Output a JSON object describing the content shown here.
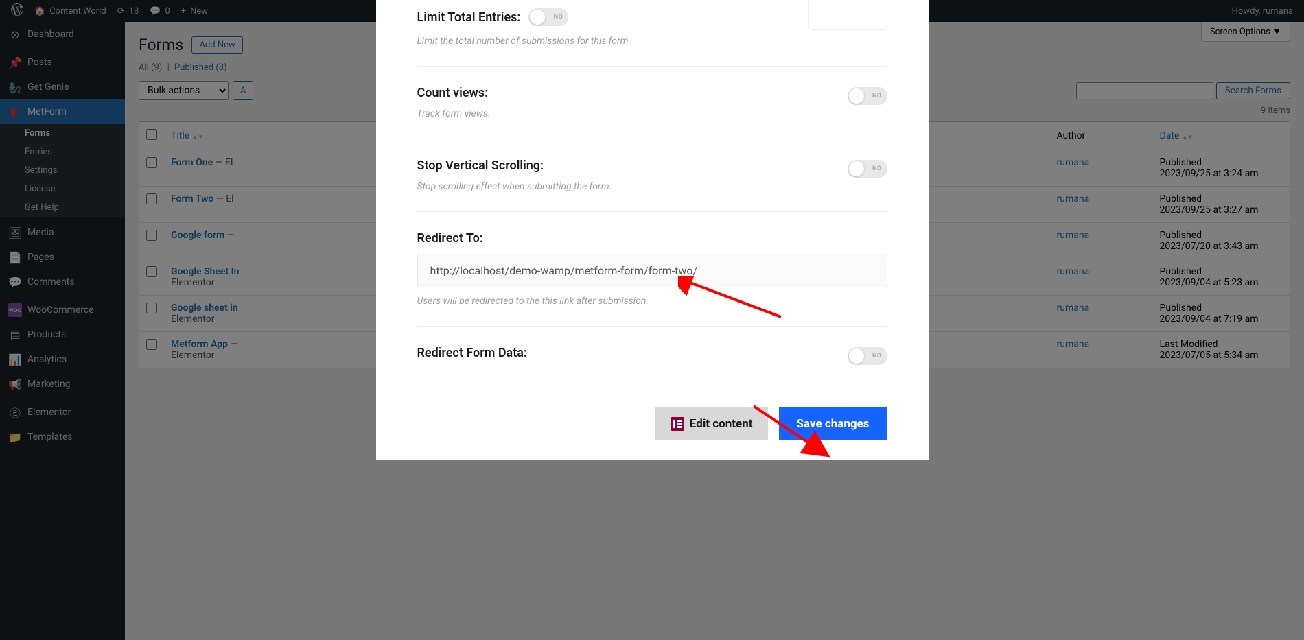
{
  "admin_bar": {
    "site_name": "Content World",
    "updates_count": "18",
    "comments_count": "0",
    "new_label": "New",
    "howdy": "Howdy, rumana"
  },
  "sidebar": {
    "items": [
      {
        "label": "Dashboard",
        "icon": "dashboard"
      },
      {
        "label": "Posts",
        "icon": "pin"
      },
      {
        "label": "Get Genie",
        "icon": "genie"
      },
      {
        "label": "MetForm",
        "icon": "metform",
        "active": true
      },
      {
        "label": "Media",
        "icon": "media"
      },
      {
        "label": "Pages",
        "icon": "pages"
      },
      {
        "label": "Comments",
        "icon": "comments"
      },
      {
        "label": "WooCommerce",
        "icon": "woo"
      },
      {
        "label": "Products",
        "icon": "products"
      },
      {
        "label": "Analytics",
        "icon": "analytics"
      },
      {
        "label": "Marketing",
        "icon": "marketing"
      },
      {
        "label": "Elementor",
        "icon": "elementor"
      },
      {
        "label": "Templates",
        "icon": "templates"
      }
    ],
    "submenu": [
      {
        "label": "Forms",
        "current": true
      },
      {
        "label": "Entries"
      },
      {
        "label": "Settings"
      },
      {
        "label": "License"
      },
      {
        "label": "Get Help"
      }
    ]
  },
  "screen_options": "Screen Options",
  "page": {
    "title": "Forms",
    "add_new": "Add New",
    "filters": {
      "all_label": "All",
      "all_count": "(9)",
      "published_label": "Published",
      "published_count": "(8)"
    },
    "bulk_actions": "Bulk actions",
    "search_button": "Search Forms",
    "items_count": "9 items"
  },
  "table": {
    "columns": {
      "title": "Title",
      "author": "Author",
      "date": "Date"
    },
    "rows": [
      {
        "title": "Form One",
        "suffix": " — El",
        "author": "rumana",
        "status": "Published",
        "date": "2023/09/25 at 3:24 am"
      },
      {
        "title": "Form Two",
        "suffix": " — El",
        "author": "rumana",
        "status": "Published",
        "date": "2023/09/25 at 3:27 am"
      },
      {
        "title": "Google form",
        "suffix": " —",
        "author": "rumana",
        "status": "Published",
        "date": "2023/07/20 at 3:43 am"
      },
      {
        "title": "Google Sheet In",
        "suffix": "",
        "sub": "Elementor",
        "author": "rumana",
        "status": "Published",
        "date": "2023/09/04 at 5:23 am"
      },
      {
        "title": "Google sheet in",
        "suffix": "",
        "sub": "Elementor",
        "author": "rumana",
        "status": "Published",
        "date": "2023/09/04 at 7:19 am"
      },
      {
        "title": "Metform App",
        "suffix": " —",
        "sub": "Elementor",
        "author": "rumana",
        "status": "Last Modified",
        "date": "2023/07/05 at 5:34 am"
      }
    ]
  },
  "modal": {
    "fields": {
      "limit_entries": {
        "label": "Limit Total Entries:",
        "description": "Limit the total number of submissions for this form.",
        "value": "NO"
      },
      "count_views": {
        "label": "Count views:",
        "description": "Track form views.",
        "value": "NO"
      },
      "stop_scrolling": {
        "label": "Stop Vertical Scrolling:",
        "description": "Stop scrolling effect when submitting the form.",
        "value": "NO"
      },
      "redirect_to": {
        "label": "Redirect To:",
        "value": "http://localhost/demo-wamp/metform-form/form-two/",
        "description": "Users will be redirected to the this link after submission."
      },
      "redirect_data": {
        "label": "Redirect Form Data:",
        "value": "NO"
      }
    },
    "edit_content": "Edit content",
    "save_changes": "Save changes"
  }
}
